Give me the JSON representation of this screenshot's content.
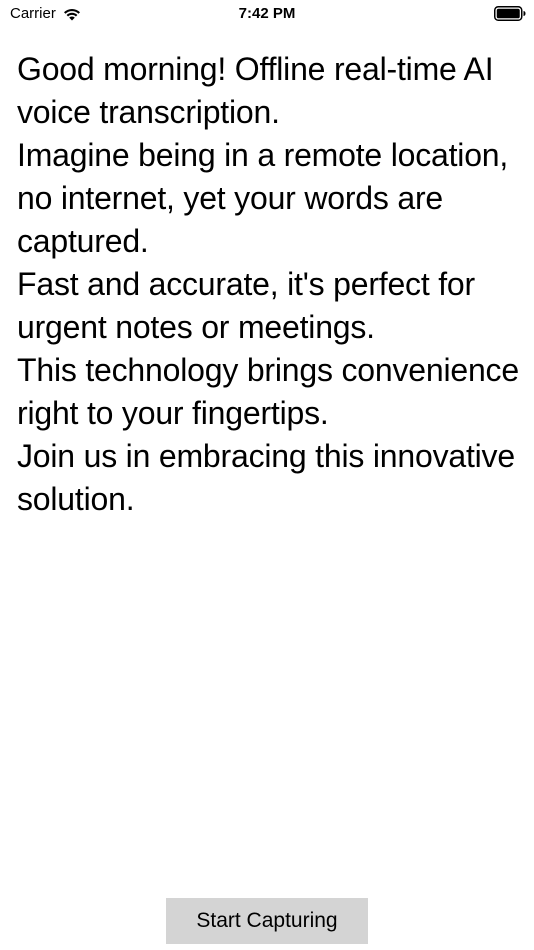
{
  "status_bar": {
    "carrier": "Carrier",
    "time": "7:42 PM",
    "wifi_icon": "wifi-icon",
    "battery_icon": "battery-full-icon"
  },
  "transcript": {
    "lines": [
      "Good morning! Offline real-time AI voice transcription.",
      "Imagine being in a remote location, no internet, yet your words are captured.",
      "Fast and accurate, it's perfect for urgent notes or meetings.",
      "This technology brings convenience right to your fingertips.",
      "Join us in embracing this innovative solution."
    ]
  },
  "controls": {
    "start_label": "Start Capturing",
    "button_color": "#d4d4d4"
  }
}
